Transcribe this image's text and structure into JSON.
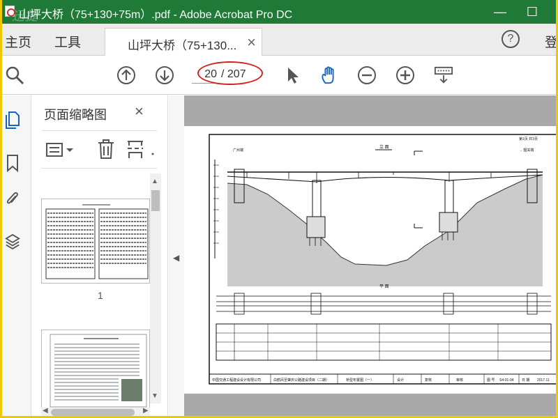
{
  "window": {
    "title": "山坪大桥（75+130+75m）.pdf - Adobe Acrobat Pro DC",
    "watermark": "迅捷",
    "minimize": "—",
    "maximize": "☐"
  },
  "tabs": {
    "home": "主页",
    "tools": "工具",
    "document": "山坪大桥（75+130...",
    "close": "×",
    "help": "?",
    "login": "登"
  },
  "toolbar": {
    "current_page": "20",
    "total_pages": "/ 207",
    "icons": [
      "search-icon",
      "page-up-icon",
      "page-down-icon",
      "select-arrow-icon",
      "hand-icon",
      "zoom-out-icon",
      "zoom-in-icon",
      "keyboard-icon"
    ],
    "annotation_color": "#d21f1f"
  },
  "panel": {
    "title": "页面缩略图",
    "close": "×",
    "thumbnail_1_label": "1"
  },
  "document": {
    "elevation_label": "立 面",
    "plan_label": "平 面",
    "left_dest": "广州端",
    "right_dest": "→ 韶关端",
    "sheet_label": "第1页  共3页",
    "company": "中国交通工程建设设计有限公司",
    "project": "白鹤凤至肇庆公路建设项目（二期）",
    "drawing_title": "桥型布置图（一）",
    "design": "设计",
    "review": "复核",
    "approve": "审核",
    "drawing_no_label": "图 号",
    "drawing_no": "S4-01-04",
    "date_label": "日 期",
    "date": "2017.11"
  }
}
